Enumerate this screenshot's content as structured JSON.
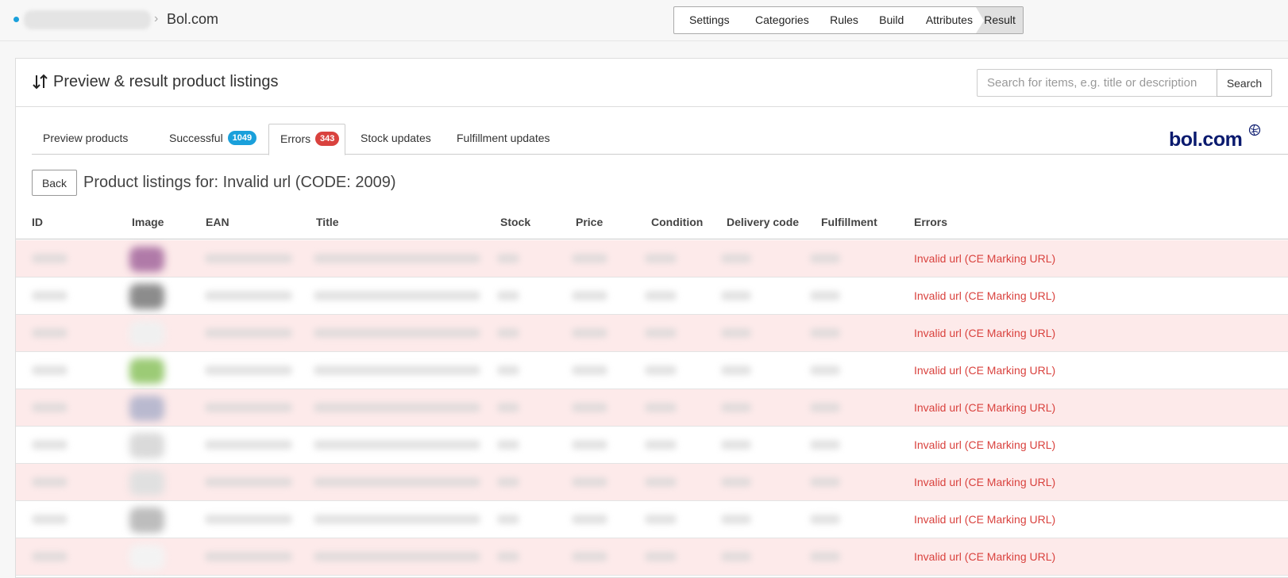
{
  "breadcrumb": {
    "title": "Bol.com"
  },
  "steps": [
    {
      "label": "Settings"
    },
    {
      "label": "Categories"
    },
    {
      "label": "Rules"
    },
    {
      "label": "Build"
    },
    {
      "label": "Attributes"
    },
    {
      "label": "Result",
      "active": true
    }
  ],
  "header": {
    "title": "Preview & result product listings",
    "search_placeholder": "Search for items, e.g. title or description",
    "search_button": "Search"
  },
  "tabs": [
    {
      "label": "Preview products"
    },
    {
      "label": "Successful",
      "badge": "1049"
    },
    {
      "label": "Errors",
      "badge": "343",
      "active": true
    },
    {
      "label": "Stock updates"
    },
    {
      "label": "Fulfillment updates"
    }
  ],
  "logo": {
    "text": "bol.com"
  },
  "back_button": "Back",
  "list_heading": "Product listings for: Invalid url (CODE: 2009)",
  "table": {
    "columns": [
      "ID",
      "Image",
      "EAN",
      "Title",
      "Stock",
      "Price",
      "Condition",
      "Delivery code",
      "Fulfillment",
      "Errors"
    ],
    "rows": [
      {
        "error": "Invalid url (CE Marking URL)",
        "image_color": "#b07aa8"
      },
      {
        "error": "Invalid url (CE Marking URL)",
        "image_color": "#8c8c8c"
      },
      {
        "error": "Invalid url (CE Marking URL)",
        "image_color": "#f0f0f0"
      },
      {
        "error": "Invalid url (CE Marking URL)",
        "image_color": "#9ccb76"
      },
      {
        "error": "Invalid url (CE Marking URL)",
        "image_color": "#b9b9cf"
      },
      {
        "error": "Invalid url (CE Marking URL)",
        "image_color": "#dadada"
      },
      {
        "error": "Invalid url (CE Marking URL)",
        "image_color": "#e0e0e0"
      },
      {
        "error": "Invalid url (CE Marking URL)",
        "image_color": "#bdbdbd"
      },
      {
        "error": "Invalid url (CE Marking URL)",
        "image_color": "#f3f3f3"
      }
    ]
  },
  "colors": {
    "accent": "#1aa0db",
    "error": "#d9423e",
    "error_row": "#fdeaea",
    "logo": "#0a1a6e"
  }
}
